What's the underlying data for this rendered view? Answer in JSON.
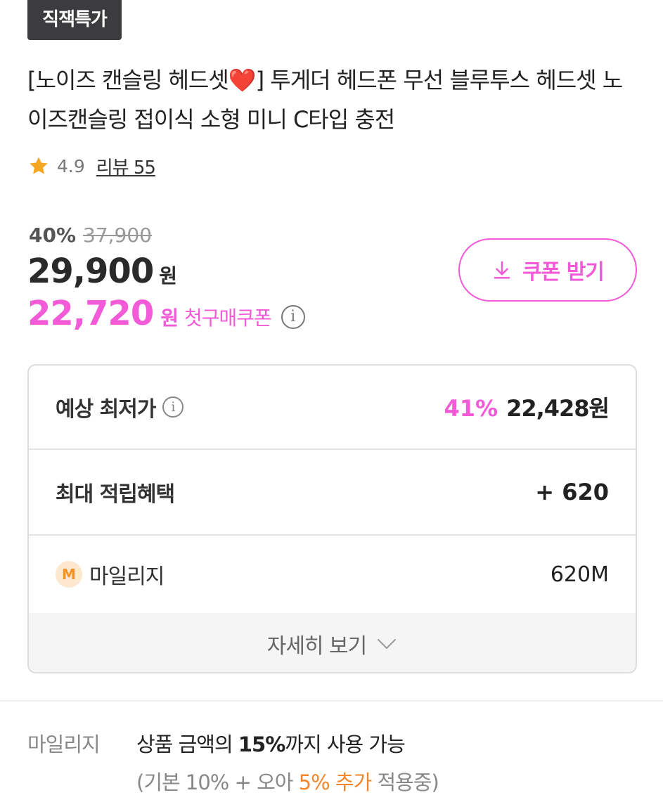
{
  "badge": {
    "label": "직잭특가"
  },
  "product": {
    "title_prefix": "[노이즈 캔슬링 헤드셋",
    "title_heart": "❤️",
    "title_suffix": "] 투게더 헤드폰 무선 블루투스 헤드셋 노이즈캔슬링 접이식 소형 미니 C타입 충전"
  },
  "rating": {
    "score": "4.9",
    "review_label": "리뷰 55",
    "star_color": "#f5a623"
  },
  "price": {
    "discount_rate": "40%",
    "original": "37,900",
    "current": "29,900",
    "currency": "원",
    "coupon_price": "22,720",
    "coupon_currency": "원",
    "coupon_label": "첫구매쿠폰",
    "info_icon": "i"
  },
  "coupon_button": {
    "label": "쿠폰 받기",
    "icon": "download-icon",
    "accent": "#f25ad7"
  },
  "benefits": {
    "lowest_label": "예상 최저가",
    "lowest_info_icon": "i",
    "lowest_pct": "41%",
    "lowest_price": "22,428원",
    "points_label": "최대 적립혜택",
    "points_value": "+ 620",
    "mileage_badge": "M",
    "mileage_label": "마일리지",
    "mileage_value": "620M",
    "more_label": "자세히 보기"
  },
  "mileage_info": {
    "label": "마일리지",
    "line1_pre": "상품 금액의 ",
    "line1_bold": "15%",
    "line1_post": "까지 사용 가능",
    "line2_pre": "(기본 10% + 오아 ",
    "line2_orange": "5% 추가",
    "line2_post": " 적용중)"
  }
}
